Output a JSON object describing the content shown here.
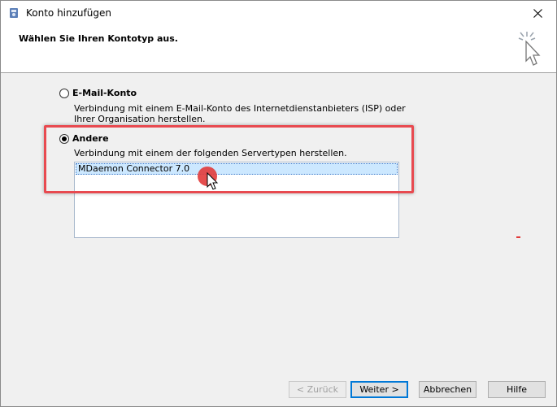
{
  "window": {
    "title": "Konto hinzufügen",
    "heading": "Wählen Sie Ihren Kontotyp aus."
  },
  "options": [
    {
      "label": "E-Mail-Konto",
      "description": "Verbindung mit einem E-Mail-Konto des Internetdienstanbieters (ISP) oder Ihrer Organisation herstellen.",
      "selected": false
    },
    {
      "label": "Andere",
      "description": "Verbindung mit einem der folgenden Servertypen herstellen.",
      "selected": true
    }
  ],
  "server_list": {
    "items": [
      "MDaemon Connector 7.0"
    ],
    "selected": "MDaemon Connector 7.0"
  },
  "buttons": {
    "back": "< Zurück",
    "next": "Weiter >",
    "cancel": "Abbrechen",
    "help": "Hilfe"
  },
  "colors": {
    "highlight": "#e84a50",
    "selection": "#cce8ff",
    "accent": "#0078d7"
  }
}
